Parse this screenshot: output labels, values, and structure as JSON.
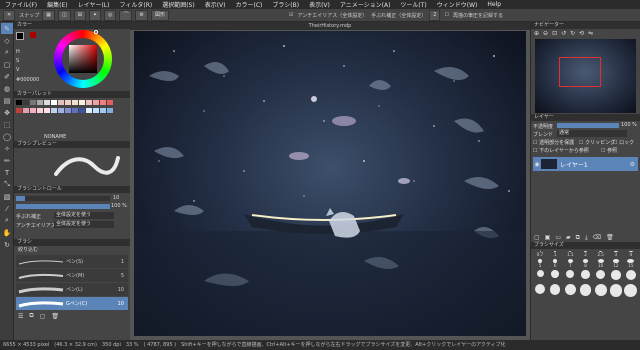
{
  "menu": [
    "ファイル(F)",
    "編集(E)",
    "レイヤー(L)",
    "フィルタ(R)",
    "選択範囲(S)",
    "表示(V)",
    "カラー(C)",
    "ブラシ(B)",
    "表示(V)",
    "アニメーション(A)",
    "ツール(T)",
    "ウィンドウ(W)",
    "Help"
  ],
  "options": {
    "snap_label": "スナップ",
    "shape_label": "図形",
    "aa_label": "アンチエイリアス（全体設定）",
    "stabilizer_label": "手ぶれ補正（全体設定）",
    "stabilizer_value": "2",
    "sync_label": "再描の筆圧を記録する"
  },
  "tabs": {
    "doc_title": "TheirHistory.mdp"
  },
  "color": {
    "header": "カラー",
    "hex_value": "#000000",
    "palette_header": "カラーパレット",
    "noname": "NONAME",
    "palette": [
      "#000000",
      "#3a3a3a",
      "#777777",
      "#aaaaaa",
      "#dddddd",
      "#ffffff",
      "#e0c0c0",
      "#f0d0c0",
      "#f0e0d0",
      "#f8f0e0",
      "#f0c0c0",
      "#f0a0a0",
      "#f08080",
      "#e06060",
      "#c04040",
      "#e0a0b0",
      "#f0b0c0",
      "#f8d0d8",
      "#ffe0e8",
      "#c0d0f0",
      "#a0b0e0",
      "#8090d0",
      "#6070c0",
      "#4050a0",
      "#e0f0ff",
      "#c0e0ff",
      "#a0c8f0",
      "#80b0e0"
    ]
  },
  "brush_preview": {
    "header": "ブラシプレビュー"
  },
  "brush_control": {
    "header": "ブラシコントロール",
    "size_value": "10",
    "opacity_value": "100 %",
    "stabilizer_label": "手ぶれ補正",
    "stabilizer_value": "全体設定を使う",
    "aa_label": "アンチエイリアス",
    "aa_value": "全体設定を使う"
  },
  "brush_list": {
    "header": "ブラシ",
    "filter_label": "絞り込む",
    "items": [
      {
        "label": "ペン(S)",
        "size": "1"
      },
      {
        "label": "ペン(M)",
        "size": "5"
      },
      {
        "label": "ペン(L)",
        "size": "10"
      },
      {
        "label": "Gペン(C)",
        "size": "10"
      }
    ]
  },
  "navigator": {
    "header": "ナビゲーター"
  },
  "layers": {
    "header": "レイヤー",
    "opacity_label": "不透明度",
    "opacity_value": "100 %",
    "blend_label": "ブレンド",
    "blend_value": "通常",
    "protect_label": "透明部分を保護",
    "clipping_label": "クリッピング",
    "lock_label": "ロック",
    "all_layers_label": "下のレイヤーから参照",
    "ref_label": "参照",
    "items": [
      {
        "name": "レイヤー1"
      }
    ]
  },
  "brush_size": {
    "header": "ブラシサイズ",
    "rows": [
      [
        "0.7",
        "1",
        "1.5",
        "2",
        "2.5",
        "3",
        "4"
      ],
      [
        "5",
        "6",
        "7",
        "8",
        "10",
        "12",
        "15"
      ],
      [
        "20",
        "25",
        "30",
        "35",
        "40",
        "50",
        "60"
      ],
      [
        "70",
        "80",
        "100",
        "120",
        "150",
        "200",
        "250"
      ]
    ]
  },
  "status": {
    "text": "6655 × 4533 pixel　(46.3 × 32.9 cm)　350 dpi　33 %　( 4787, 895 )　Shift+キーを押しながらで直線描画、Ctrl+Alt+キーを押しながら左右ドラッグでブラシサイズを変更、Alt+クリックでレイヤーのアクティブ化"
  },
  "colors": {
    "accent": "#5b84b8",
    "panel": "#454545",
    "dark": "#2b2b2b"
  }
}
